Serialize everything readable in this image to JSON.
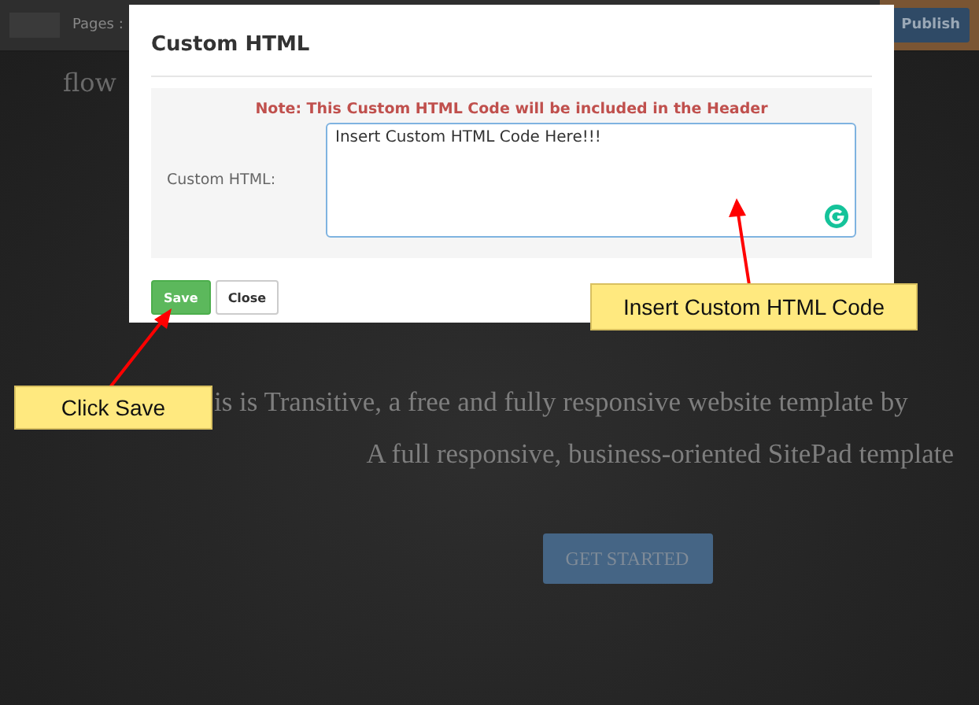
{
  "top_bar": {
    "pages_label": "Pages :",
    "publish_button": "Publish"
  },
  "page": {
    "heading": "flow",
    "tagline": "is is Transitive, a free and fully responsive website template by",
    "subtitle": "A full responsive, business-oriented SitePad template",
    "cta_button": "GET STARTED"
  },
  "modal": {
    "title": "Custom HTML",
    "note": "Note: This Custom HTML Code will be included in the Header",
    "field": {
      "label": "Custom HTML:",
      "value": "Insert Custom HTML Code Here!!!"
    },
    "buttons": [
      {
        "label": "Save",
        "kind": "primary"
      },
      {
        "label": "Close",
        "kind": "default"
      }
    ]
  },
  "callouts": [
    {
      "text": "Insert Custom HTML Code"
    },
    {
      "text": "Click Save"
    }
  ]
}
